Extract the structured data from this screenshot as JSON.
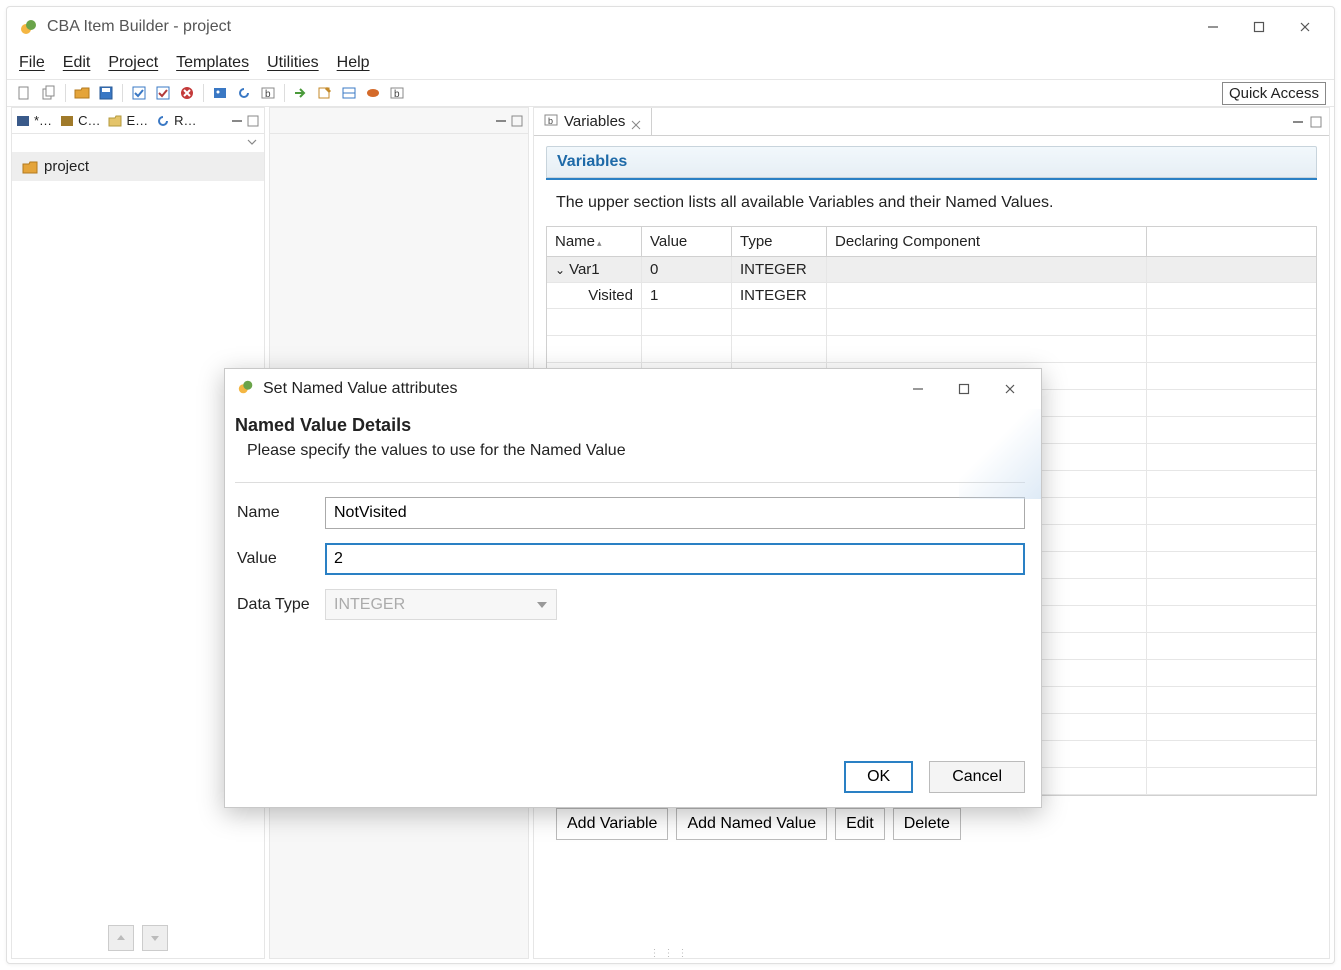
{
  "window": {
    "title": "CBA Item Builder - project"
  },
  "menu": {
    "file": "File",
    "edit": "Edit",
    "project": "Project",
    "templates": "Templates",
    "utilities": "Utilities",
    "help": "Help"
  },
  "toolbar": {
    "quick_access": "Quick Access"
  },
  "left_tabs": {
    "t1": "*…",
    "t2": "C…",
    "t3": "E…",
    "t4": "R…"
  },
  "tree": {
    "project": "project"
  },
  "right_tab": {
    "label": "Variables"
  },
  "variables": {
    "section_title": "Variables",
    "description": "The upper section lists all available Variables and their Named Values.",
    "columns": {
      "name": "Name",
      "value": "Value",
      "type": "Type",
      "decl": "Declaring Component"
    },
    "rows": [
      {
        "name": "Var1",
        "value": "0",
        "type": "INTEGER",
        "decl": "",
        "expandable": true,
        "selected": true,
        "indent": 0
      },
      {
        "name": "Visited",
        "value": "1",
        "type": "INTEGER",
        "decl": "",
        "expandable": false,
        "selected": false,
        "indent": 1
      }
    ],
    "buttons": {
      "add_var": "Add Variable",
      "add_named": "Add Named Value",
      "edit": "Edit",
      "delete": "Delete"
    }
  },
  "dialog": {
    "title": "Set Named Value attributes",
    "heading": "Named Value Details",
    "sub": "Please specify the values to use for the Named Value",
    "labels": {
      "name": "Name",
      "value": "Value",
      "datatype": "Data Type"
    },
    "fields": {
      "name": "NotVisited",
      "value": "2",
      "datatype": "INTEGER"
    },
    "buttons": {
      "ok": "OK",
      "cancel": "Cancel"
    }
  }
}
